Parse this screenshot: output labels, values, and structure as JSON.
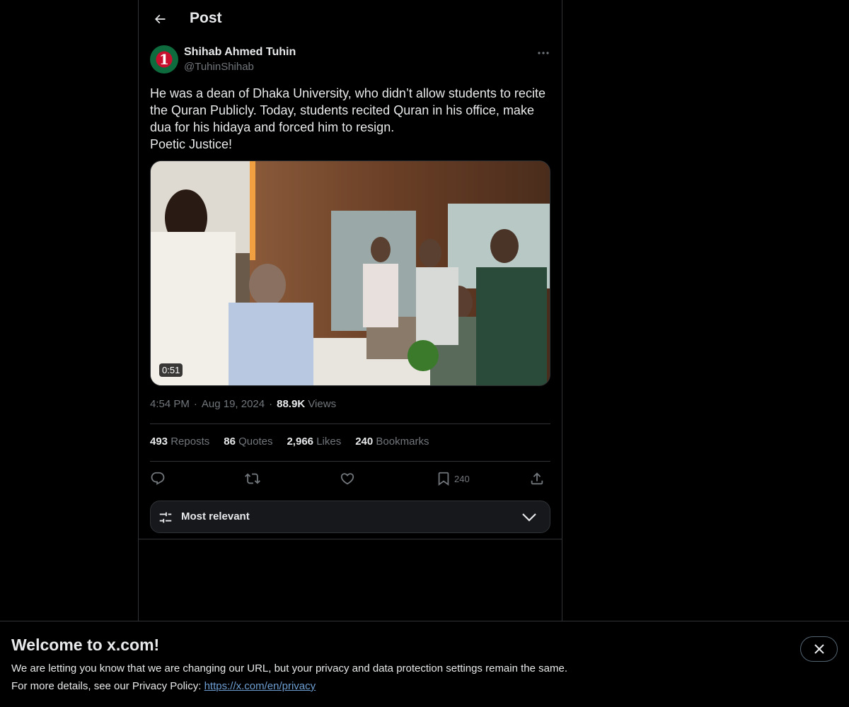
{
  "header": {
    "title": "Post",
    "back_icon": "arrow-left-icon"
  },
  "author": {
    "name": "Shihab Ahmed Tuhin",
    "handle": "@TuhinShihab",
    "avatar_digit": "1"
  },
  "post": {
    "text": "He was a dean of Dhaka University, who didn’t allow students to recite\nthe Quran Publicly. Today, students recited Quran in his office, make\ndua for his hidaya and forced him to resign.\nPoetic Justice!",
    "video_duration": "0:51",
    "time": "4:54 PM",
    "date": "Aug 19, 2024",
    "views_count": "88.9K",
    "views_label": "Views",
    "separator": "·"
  },
  "stats": {
    "reposts_count": "493",
    "reposts_label": "Reposts",
    "quotes_count": "86",
    "quotes_label": "Quotes",
    "likes_count": "2,966",
    "likes_label": "Likes",
    "bookmarks_count": "240",
    "bookmarks_label": "Bookmarks"
  },
  "actions": {
    "bookmark_count": "240"
  },
  "sort": {
    "label": "Most relevant"
  },
  "banner": {
    "title": "Welcome to x.com!",
    "line1": "We are letting you know that we are changing our URL, but your privacy and data protection settings remain the same.",
    "line2_prefix": "For more details, see our Privacy Policy: ",
    "link_text": "https://x.com/en/privacy"
  },
  "colors": {
    "background": "#000000",
    "text": "#e7e9ea",
    "muted": "#71767b",
    "border": "#2f3336",
    "link": "#6e9fd4"
  }
}
